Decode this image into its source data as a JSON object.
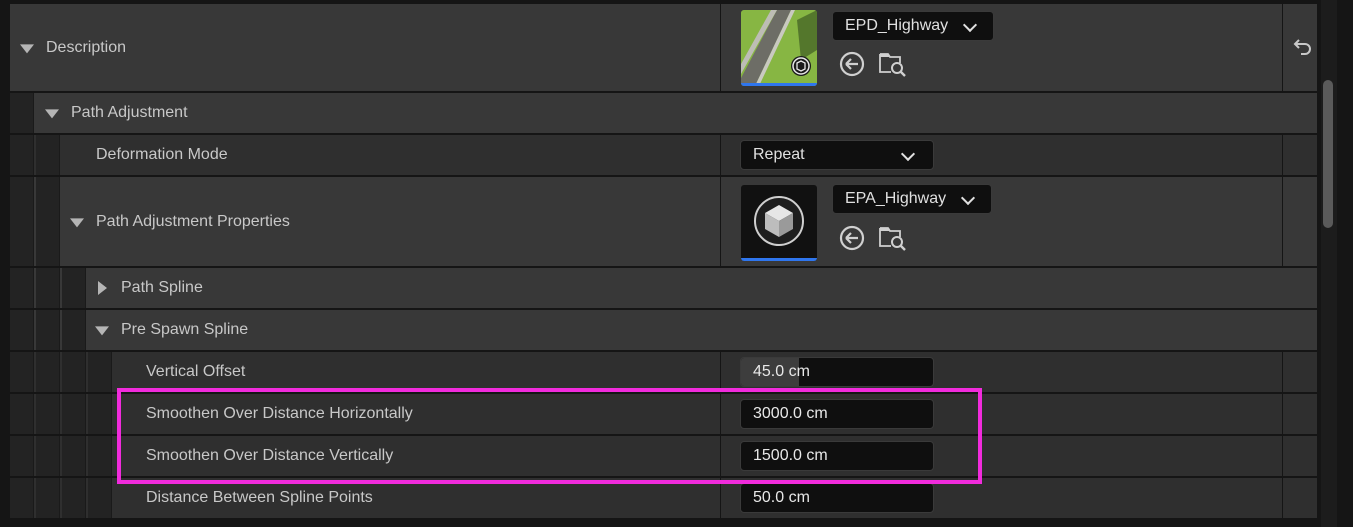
{
  "rows": {
    "description": {
      "label": "Description",
      "asset_name": "EPD_Highway"
    },
    "path_adjustment": {
      "label": "Path Adjustment"
    },
    "deformation_mode": {
      "label": "Deformation Mode",
      "value": "Repeat"
    },
    "path_adjustment_properties": {
      "label": "Path Adjustment Properties",
      "asset_name": "EPA_Highway"
    },
    "path_spline": {
      "label": "Path Spline"
    },
    "pre_spawn_spline": {
      "label": "Pre Spawn Spline"
    },
    "vertical_offset": {
      "label": "Vertical Offset",
      "value": "45.0 cm",
      "slider_fill": 0.3
    },
    "smoothen_horizontal": {
      "label": "Smoothen Over Distance Horizontally",
      "value": "3000.0 cm"
    },
    "smoothen_vertical": {
      "label": "Smoothen Over Distance Vertically",
      "value": "1500.0 cm"
    },
    "distance_between_points": {
      "label": "Distance Between Spline Points",
      "value": "50.0 cm"
    }
  },
  "icons": {
    "use_selected": "arrow-left-circle-icon",
    "browse": "folder-search-icon",
    "reset": "reset-arrow-icon"
  },
  "colors": {
    "highlight": "#f12bdc",
    "thumbnail_underline": "#2f76ee"
  }
}
